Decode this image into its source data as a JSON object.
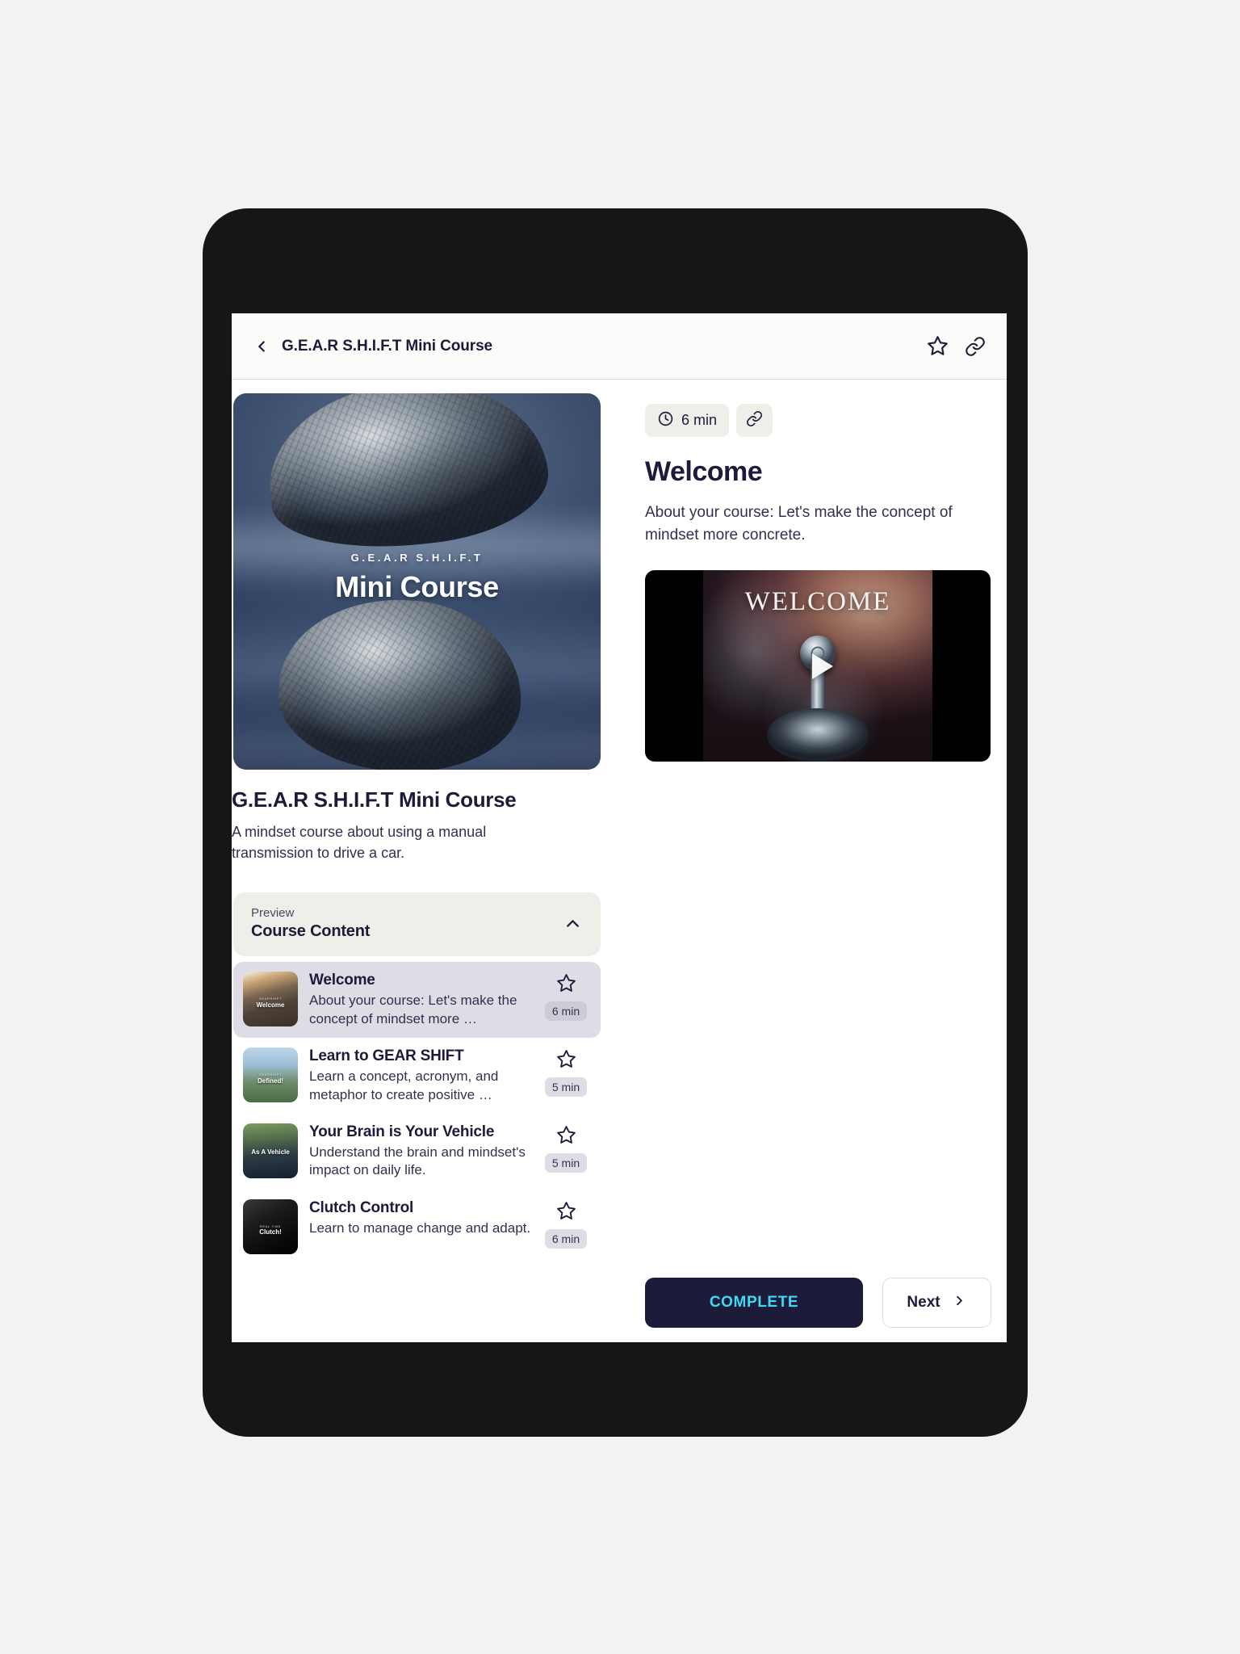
{
  "appbar": {
    "title": "G.E.A.R S.H.I.F.T Mini Course",
    "back_icon": "chevron-left-icon",
    "star_icon": "star-outline-icon",
    "link_icon": "link-icon"
  },
  "course": {
    "hero_kicker": "G.E.A.R S.H.I.F.T",
    "hero_title": "Mini Course",
    "title": "G.E.A.R S.H.I.F.T Mini Course",
    "description": "A mindset course about using a manual transmission to drive a car."
  },
  "accordion": {
    "kicker": "Preview",
    "title": "Course Content",
    "chevron": "chevron-up-icon"
  },
  "lessons": [
    {
      "title": "Welcome",
      "description": "About your course: Let's make the concept of mindset more …",
      "duration": "6 min",
      "thumb_kicker": "GEARSHIFT",
      "thumb_label": "Welcome",
      "selected": true
    },
    {
      "title": "Learn to GEAR SHIFT",
      "description": "Learn a concept, acronym, and metaphor to create positive …",
      "duration": "5 min",
      "thumb_kicker": "GEARSHIFT",
      "thumb_label": "Defined!",
      "selected": false
    },
    {
      "title": "Your Brain is Your Vehicle",
      "description": "Understand the brain and mindset's impact on daily life.",
      "duration": "5 min",
      "thumb_kicker": "",
      "thumb_label": "As A Vehicle",
      "selected": false
    },
    {
      "title": "Clutch Control",
      "description": "Learn to manage change and adapt.",
      "duration": "6 min",
      "thumb_kicker": "REAL TIME",
      "thumb_label": "Clutch!",
      "selected": false
    }
  ],
  "detail": {
    "duration": "6 min",
    "clock_icon": "clock-icon",
    "link_icon": "link-icon",
    "heading": "Welcome",
    "subtitle": "About your course: Let's make the concept of mindset more concrete.",
    "video_word": "WELCOME",
    "play_icon": "play-icon"
  },
  "footer": {
    "complete_label": "COMPLETE",
    "next_label": "Next",
    "next_icon": "chevron-right-icon"
  },
  "colors": {
    "ink": "#1d1b3a",
    "accent_cyan": "#3fd8f5",
    "chip_bg": "#efeee8",
    "selected_row": "#dedde5",
    "page_bg": "#f2f2f2"
  }
}
